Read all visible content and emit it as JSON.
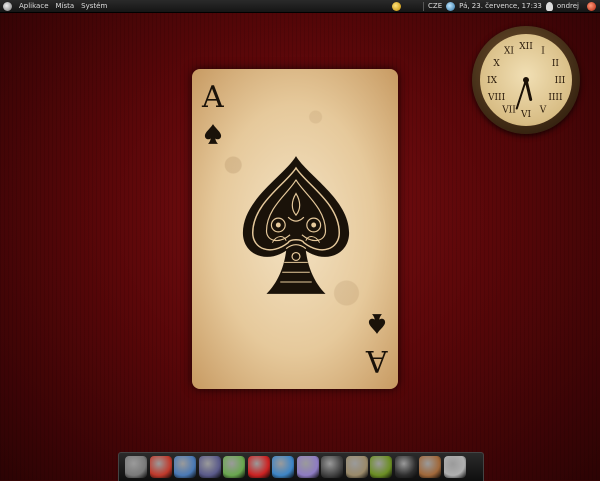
{
  "top_panel": {
    "menus": [
      "Aplikace",
      "Místa",
      "Systém"
    ],
    "keyboard_layout": "CZE",
    "datetime": "Pá, 23. července, 17:33",
    "username": "ondrej"
  },
  "card": {
    "rank": "A",
    "suit": "spade",
    "face_color": "#e6c99b",
    "ink_color": "#1a1209"
  },
  "clock": {
    "numerals": [
      "XII",
      "I",
      "II",
      "III",
      "IIII",
      "V",
      "VI",
      "VII",
      "VIII",
      "IX",
      "X",
      "XI"
    ],
    "hour": 17,
    "minute": 33
  },
  "dock": {
    "items": [
      {
        "name": "system-monitor-icon",
        "color": "#7a7a7a"
      },
      {
        "name": "firefox-icon",
        "color": "#c0392b"
      },
      {
        "name": "thunderbird-icon",
        "color": "#4a79b6"
      },
      {
        "name": "pidgin-icon",
        "color": "#5a5a8a"
      },
      {
        "name": "calculator-icon",
        "color": "#6aa84f"
      },
      {
        "name": "stop-icon",
        "color": "#cc2222"
      },
      {
        "name": "browser-globe-icon",
        "color": "#3d85c6"
      },
      {
        "name": "image-viewer-icon",
        "color": "#8e7cc3"
      },
      {
        "name": "blender-icon",
        "color": "#444444"
      },
      {
        "name": "gimp-icon",
        "color": "#9a8a6a"
      },
      {
        "name": "inkscape-icon",
        "color": "#6b8e23"
      },
      {
        "name": "terminal-icon",
        "color": "#2e2e2e"
      },
      {
        "name": "package-icon",
        "color": "#a0683a"
      },
      {
        "name": "trash-icon",
        "color": "#b0b0b0"
      }
    ]
  }
}
